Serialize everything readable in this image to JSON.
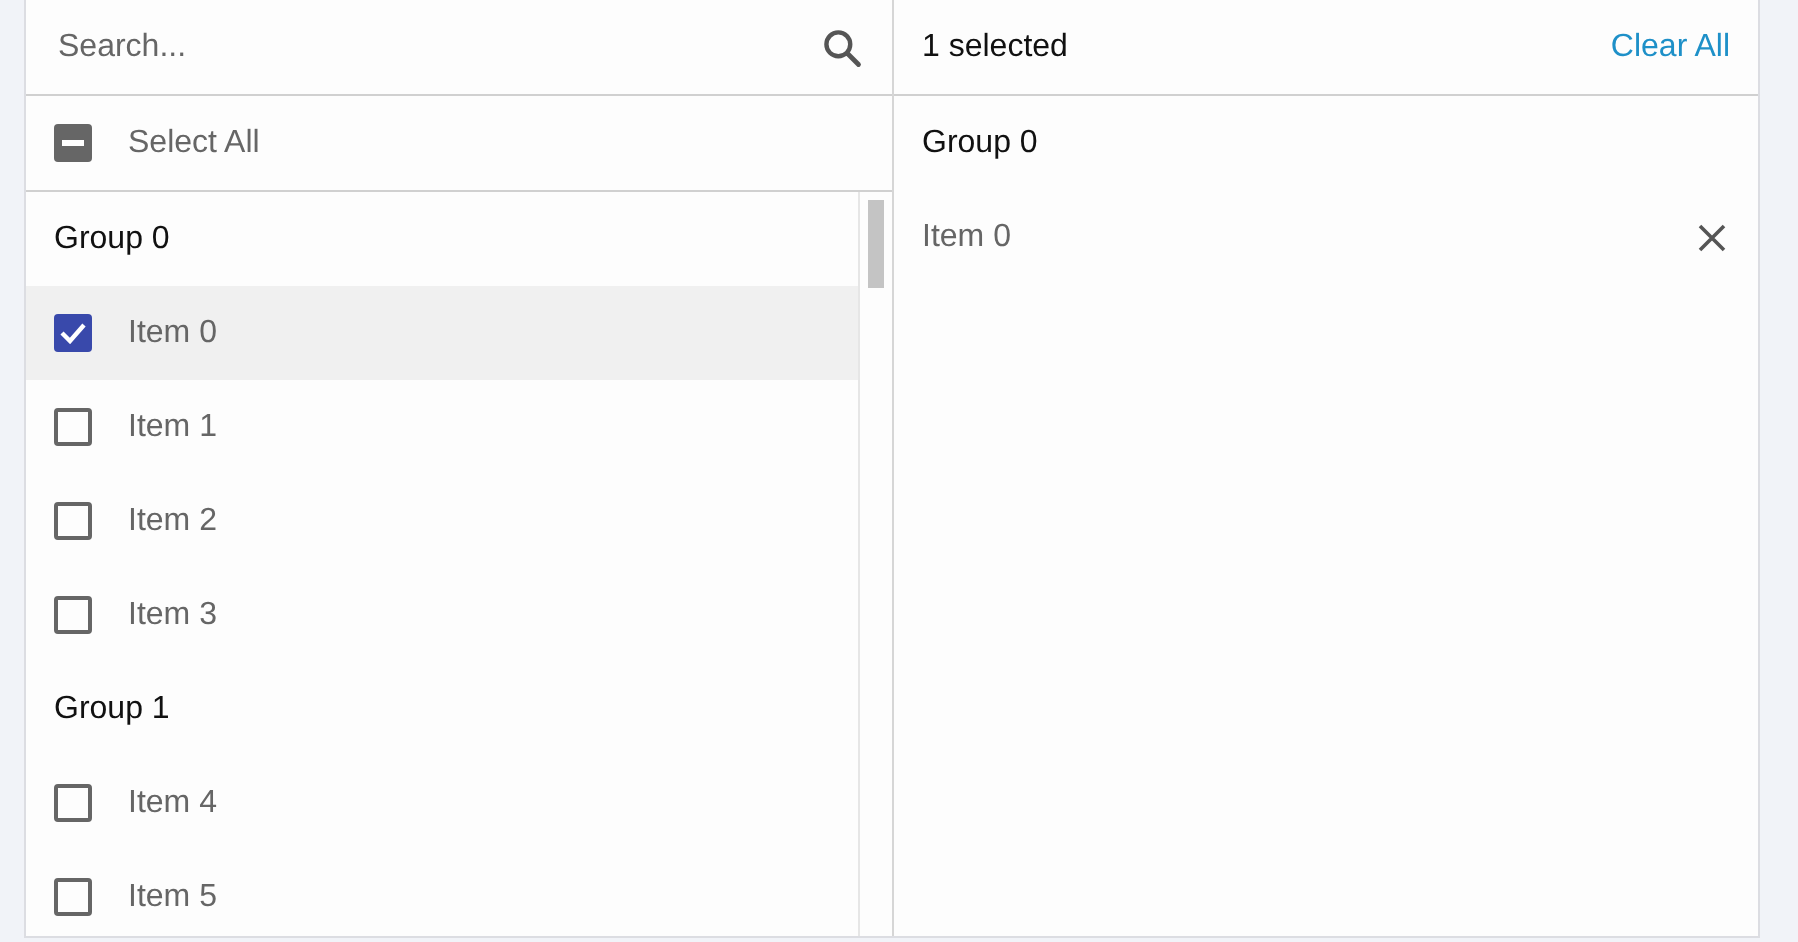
{
  "search": {
    "placeholder": "Search..."
  },
  "select_all": {
    "label": "Select All",
    "indeterminate": true
  },
  "groups": [
    {
      "label": "Group 0",
      "items": [
        {
          "label": "Item 0",
          "checked": true,
          "hovered": true
        },
        {
          "label": "Item 1",
          "checked": false,
          "hovered": false
        },
        {
          "label": "Item 2",
          "checked": false,
          "hovered": false
        },
        {
          "label": "Item 3",
          "checked": false,
          "hovered": false
        }
      ]
    },
    {
      "label": "Group 1",
      "items": [
        {
          "label": "Item 4",
          "checked": false,
          "hovered": false
        },
        {
          "label": "Item 5",
          "checked": false,
          "hovered": false
        }
      ]
    }
  ],
  "summary": {
    "count": "1 selected",
    "clear": "Clear All"
  },
  "selected_groups": [
    {
      "label": "Group 0",
      "items": [
        {
          "label": "Item 0"
        }
      ]
    }
  ]
}
